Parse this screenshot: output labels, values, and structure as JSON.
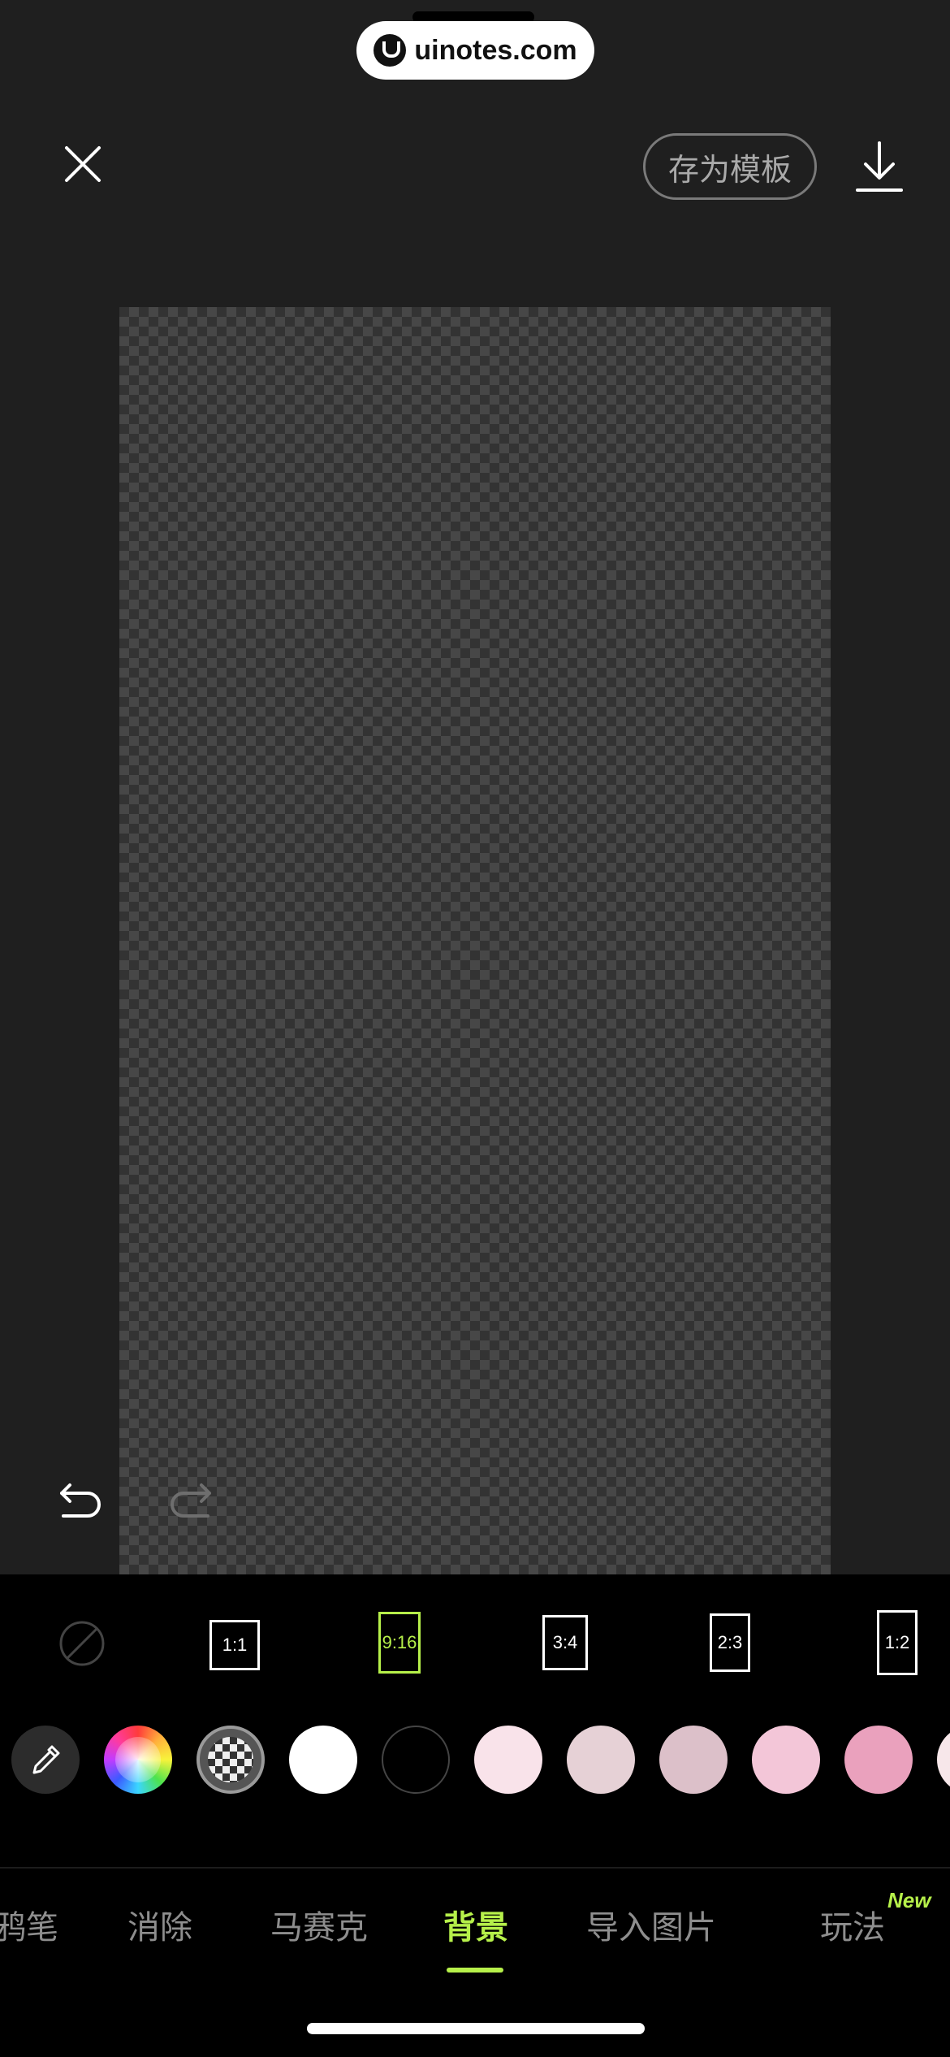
{
  "watermark": {
    "text": "uinotes.com",
    "icon": "uinotes-logo-icon"
  },
  "header": {
    "close_icon": "close-icon",
    "save_template_label": "存为模板",
    "download_icon": "download-icon"
  },
  "canvas": {
    "background": "transparent-checkerboard"
  },
  "history": {
    "undo_icon": "undo-icon",
    "redo_icon": "redo-icon"
  },
  "ratios": {
    "none_icon": "no-ratio-icon",
    "items": [
      "1:1",
      "9:16",
      "3:4",
      "2:3",
      "1:2"
    ],
    "selected": "9:16"
  },
  "colors": {
    "eyedropper_icon": "eyedropper-icon",
    "color_wheel_icon": "color-wheel-icon",
    "transparent_icon": "transparent-checker-icon",
    "swatches": [
      "#ffffff",
      "#000000",
      "#f9e3ea",
      "#e6d1d6",
      "#dcc0c9",
      "#f3c6d8",
      "#eaa1bd",
      "#f7e7ea"
    ]
  },
  "tabs": {
    "items": [
      "鸦笔",
      "消除",
      "马赛克",
      "背景",
      "导入图片",
      "玩法"
    ],
    "active": "背景",
    "new_badge": "New"
  },
  "theme": {
    "accent": "#b6f04a",
    "background": "#1f1f1f",
    "panel": "#000000"
  }
}
